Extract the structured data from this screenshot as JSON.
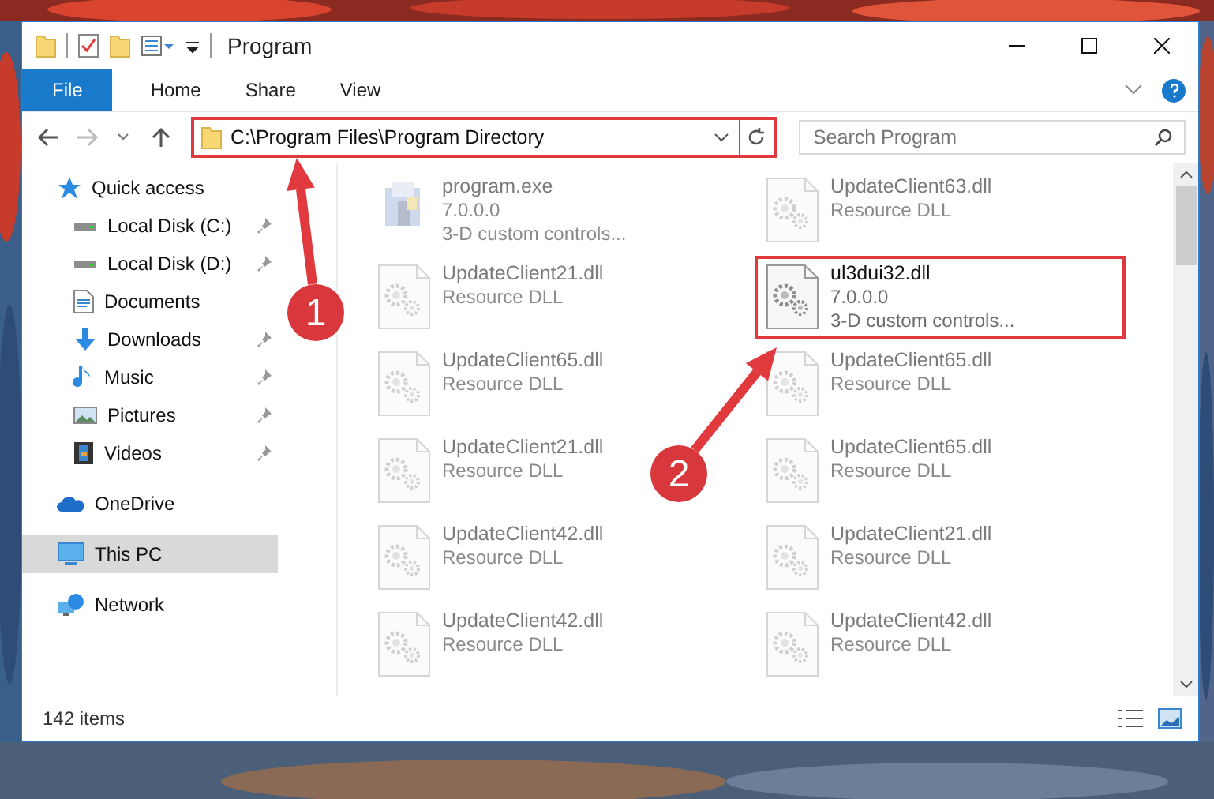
{
  "window": {
    "title": "Program"
  },
  "ribbon": {
    "tabs": [
      {
        "label": "File",
        "kind": "file"
      },
      {
        "label": "Home",
        "kind": "tab"
      },
      {
        "label": "Share",
        "kind": "tab"
      },
      {
        "label": "View",
        "kind": "tab"
      }
    ]
  },
  "address": {
    "path": "C:\\Program Files\\Program Directory",
    "highlighted": true
  },
  "search": {
    "placeholder": "Search Program"
  },
  "sidebar": {
    "items": [
      {
        "label": "Quick access",
        "kind": "star",
        "selected": false,
        "children": [
          {
            "label": "Local Disk (C:)",
            "kind": "disk",
            "pinned": true,
            "selected": false
          },
          {
            "label": "Local Disk (D:)",
            "kind": "disk",
            "pinned": true,
            "selected": false
          },
          {
            "label": "Documents",
            "kind": "documents",
            "pinned": false,
            "selected": false
          },
          {
            "label": "Downloads",
            "kind": "downloads",
            "pinned": true,
            "selected": false
          },
          {
            "label": "Music",
            "kind": "music",
            "pinned": true,
            "selected": false
          },
          {
            "label": "Pictures",
            "kind": "pictures",
            "pinned": true,
            "selected": false
          },
          {
            "label": "Videos",
            "kind": "videos",
            "pinned": true,
            "selected": false
          }
        ]
      },
      {
        "label": "OneDrive",
        "kind": "cloud",
        "selected": false
      },
      {
        "label": "This PC",
        "kind": "pc",
        "selected": true
      },
      {
        "label": "Network",
        "kind": "network",
        "selected": false
      }
    ]
  },
  "files": [
    {
      "name": "program.exe",
      "details": [
        "7.0.0.0",
        "3-D custom controls..."
      ],
      "kind": "exe",
      "dimmed": true,
      "highlighted": false
    },
    {
      "name": "UpdateClient63.dll",
      "details": [
        "Resource DLL"
      ],
      "kind": "dll",
      "dimmed": true,
      "highlighted": false
    },
    {
      "name": "UpdateClient21.dll",
      "details": [
        "Resource DLL"
      ],
      "kind": "dll",
      "dimmed": true,
      "highlighted": false
    },
    {
      "name": "ul3dui32.dll",
      "details": [
        "7.0.0.0",
        "3-D custom controls..."
      ],
      "kind": "dll",
      "dimmed": false,
      "highlighted": true
    },
    {
      "name": "UpdateClient65.dll",
      "details": [
        "Resource DLL"
      ],
      "kind": "dll",
      "dimmed": true,
      "highlighted": false
    },
    {
      "name": "UpdateClient65.dll",
      "details": [
        "Resource DLL"
      ],
      "kind": "dll",
      "dimmed": true,
      "highlighted": false
    },
    {
      "name": "UpdateClient21.dll",
      "details": [
        "Resource DLL"
      ],
      "kind": "dll",
      "dimmed": true,
      "highlighted": false
    },
    {
      "name": "UpdateClient65.dll",
      "details": [
        "Resource DLL"
      ],
      "kind": "dll",
      "dimmed": true,
      "highlighted": false
    },
    {
      "name": "UpdateClient42.dll",
      "details": [
        "Resource DLL"
      ],
      "kind": "dll",
      "dimmed": true,
      "highlighted": false
    },
    {
      "name": "UpdateClient21.dll",
      "details": [
        "Resource DLL"
      ],
      "kind": "dll",
      "dimmed": true,
      "highlighted": false
    },
    {
      "name": "UpdateClient42.dll",
      "details": [
        "Resource DLL"
      ],
      "kind": "dll",
      "dimmed": true,
      "highlighted": false
    },
    {
      "name": "UpdateClient42.dll",
      "details": [
        "Resource DLL"
      ],
      "kind": "dll",
      "dimmed": true,
      "highlighted": false
    }
  ],
  "status_bar": {
    "count": "142 items"
  },
  "annotations": [
    {
      "label": "1"
    },
    {
      "label": "2"
    }
  ]
}
